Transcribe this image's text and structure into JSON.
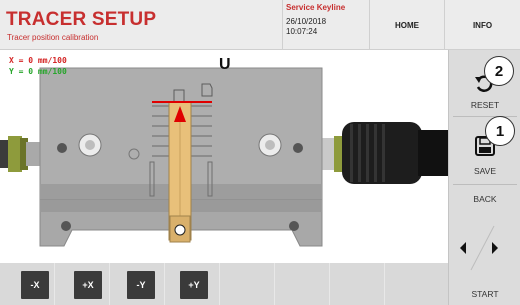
{
  "header": {
    "title": "TRACER SETUP",
    "subtitle": "Tracer position calibration",
    "service_name": "Service Keyline",
    "date": "26/10/2018",
    "time": "10:07:24",
    "home_label": "HOME",
    "info_label": "INFO"
  },
  "readouts": {
    "x": "X = 0 mm/100",
    "y": "Y = 0 mm/100",
    "x_color": "#d42525",
    "y_color": "#27a52b"
  },
  "key_profile_label": "U",
  "right_panel": {
    "reset_label": "RESET",
    "reset_icon": "rotate-left-icon",
    "save_label": "SAVE",
    "save_icon": "floppy-disk-icon",
    "back_label": "BACK",
    "start_label": "START",
    "callout_reset": "2",
    "callout_save": "1"
  },
  "jog_buttons": [
    {
      "label": "-X"
    },
    {
      "label": "+X"
    },
    {
      "label": "-Y"
    },
    {
      "label": "+Y"
    }
  ],
  "colors": {
    "brand_red": "#c72f2f",
    "marker_red": "#e00000",
    "key_blade": "#e8c07a"
  }
}
